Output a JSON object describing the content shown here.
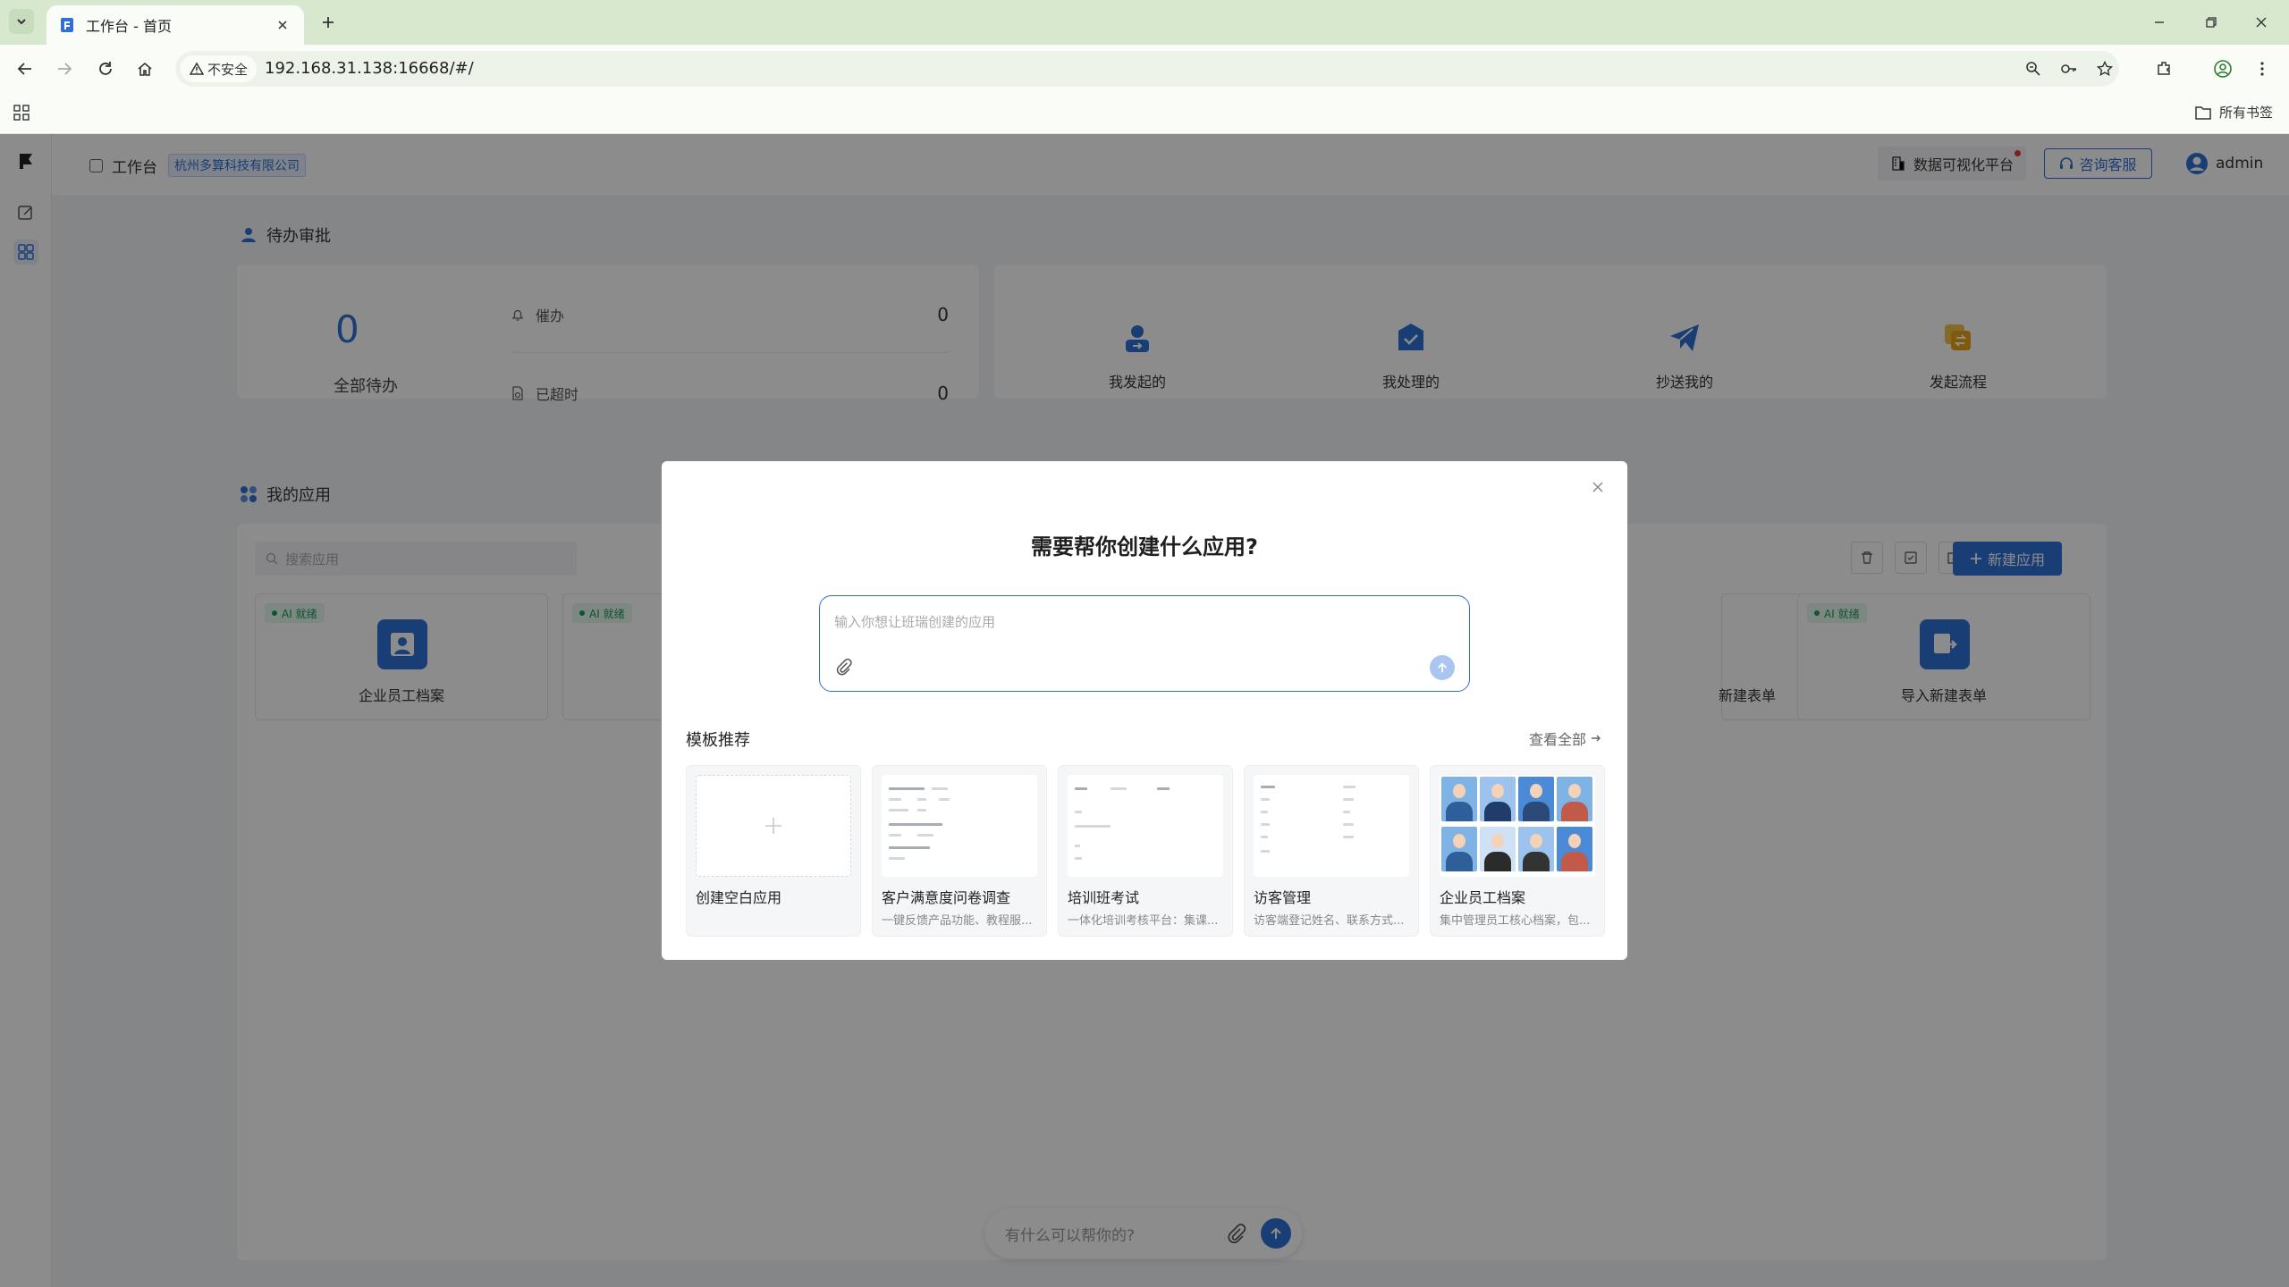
{
  "browser": {
    "tab_title": "工作台 - 首页",
    "security_label": "不安全",
    "url": "192.168.31.138:16668/#/",
    "bookmarks_label": "所有书签"
  },
  "topbar": {
    "workspace": "工作台",
    "company": "杭州多算科技有限公司",
    "data_platform": "数据可视化平台",
    "consult": "咨询客服",
    "user": "admin"
  },
  "pending": {
    "section_title": "待办审批",
    "total_value": "0",
    "total_label": "全部待办",
    "rows": [
      {
        "label": "催办",
        "value": "0"
      },
      {
        "label": "已超时",
        "value": "0"
      }
    ],
    "quick": [
      {
        "label": "我发起的",
        "icon": "user-send-icon"
      },
      {
        "label": "我处理的",
        "icon": "inbox-check-icon"
      },
      {
        "label": "抄送我的",
        "icon": "paper-plane-icon"
      },
      {
        "label": "发起流程",
        "icon": "flow-start-icon"
      }
    ]
  },
  "apps": {
    "section_title": "我的应用",
    "search_placeholder": "搜索应用",
    "new_button": "新建应用",
    "cards": [
      {
        "badge": "AI 就绪",
        "name": "企业员工档案"
      },
      {
        "badge": "AI 就绪",
        "name": ""
      },
      {
        "badge": "",
        "name": "新建表单"
      },
      {
        "badge": "AI 就绪",
        "name": "导入新建表单"
      }
    ]
  },
  "chat": {
    "placeholder": "有什么可以帮你的?"
  },
  "modal": {
    "title": "需要帮你创建什么应用?",
    "input_placeholder": "输入你想让班瑞创建的应用",
    "templates_title": "模板推荐",
    "view_all": "查看全部",
    "templates": [
      {
        "name": "创建空白应用",
        "desc": ""
      },
      {
        "name": "客户满意度问卷调查",
        "desc": "一键反馈产品功能、教程服..."
      },
      {
        "name": "培训班考试",
        "desc": "一体化培训考核平台：集课..."
      },
      {
        "name": "访客管理",
        "desc": "访客端登记姓名、联系方式..."
      },
      {
        "name": "企业员工档案",
        "desc": "集中管理员工核心档案，包..."
      }
    ]
  },
  "colors": {
    "accent": "#2f6fd6",
    "browser_frame": "#d7e8cf",
    "ai_badge": "#1a9a5c"
  }
}
